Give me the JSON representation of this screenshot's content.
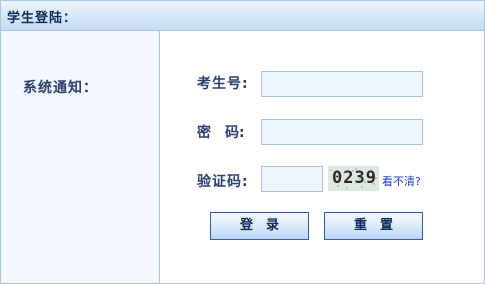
{
  "header": {
    "title": "学生登陆："
  },
  "sidebar": {
    "notice_label": "系统通知："
  },
  "form": {
    "exam_no_label": "考生号:",
    "exam_no_value": "",
    "password_label": "密　码:",
    "password_value": "",
    "captcha_label": "验证码:",
    "captcha_value": "",
    "captcha_image_text": "0239",
    "captcha_refresh_link": "看不清?",
    "login_button": "登　录",
    "reset_button": "重　置"
  },
  "colors": {
    "accent": "#2b3f6c",
    "border": "#a9c6e3",
    "input_bg": "#eef5fd",
    "link": "#1a3fb0"
  }
}
